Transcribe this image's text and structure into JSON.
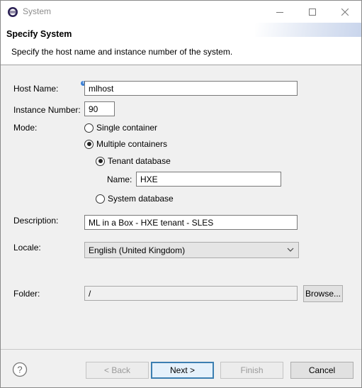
{
  "window": {
    "title": "System",
    "app_icon": "eclipse-icon",
    "controls": [
      "minimize-icon",
      "maximize-icon",
      "close-icon"
    ]
  },
  "header": {
    "title": "Specify System",
    "description": "Specify the host name and instance number of the system."
  },
  "form": {
    "host_name_label": "Host Name:",
    "host_name_value": "mlhost",
    "info_badge": "i",
    "instance_number_label": "Instance Number:",
    "instance_number_value": "90",
    "mode_label": "Mode:",
    "mode_single": "Single container",
    "mode_multiple": "Multiple containers",
    "selected_mode": "Multiple containers",
    "tenant_database": "Tenant database",
    "system_database": "System database",
    "selected_database": "Tenant database",
    "name_label": "Name:",
    "name_value": "HXE",
    "description_label": "Description:",
    "description_value": "ML in a Box - HXE tenant - SLES",
    "locale_label": "Locale:",
    "locale_value": "English (United Kingdom)",
    "folder_label": "Folder:",
    "folder_value": "/",
    "browse_label": "Browse..."
  },
  "footer": {
    "help_icon": "question-icon",
    "back_label": "< Back",
    "next_label": "Next >",
    "finish_label": "Finish",
    "cancel_label": "Cancel"
  }
}
